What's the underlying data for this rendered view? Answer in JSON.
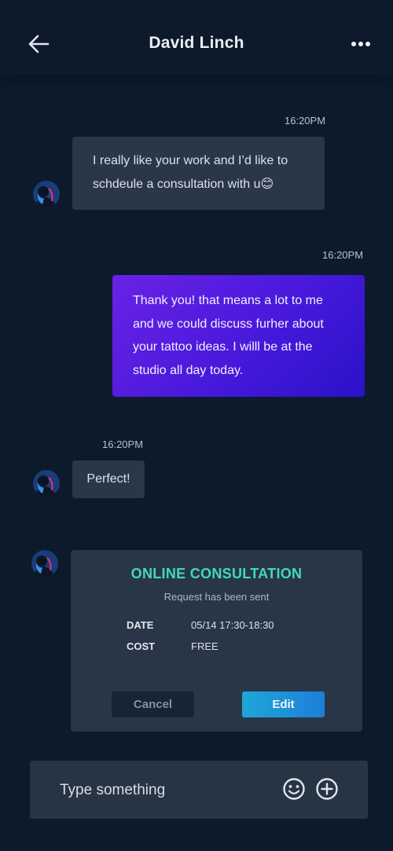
{
  "header": {
    "title": "David Linch"
  },
  "messages": [
    {
      "time": "16:20PM",
      "text_line1": "I really like your work and I’d like to",
      "text_line2": "schdeule a consultation with u",
      "emoji": "😊"
    },
    {
      "time": "16:20PM",
      "lines": [
        "Thank you! that means a lot to me",
        "and we could discuss furher about",
        "your tattoo ideas. I willl be at the",
        "studio all day today."
      ]
    },
    {
      "time": "16:20PM",
      "text": "Perfect!"
    }
  ],
  "consultation": {
    "title": "ONLINE CONSULTATION",
    "subtitle": "Request has been sent",
    "date_label": "DATE",
    "date_value": "05/14 17:30-18:30",
    "cost_label": "COST",
    "cost_value": "FREE",
    "cancel_label": "Cancel",
    "edit_label": "Edit"
  },
  "composer": {
    "placeholder": "Type something"
  },
  "colors": {
    "background": "#0c1a2c",
    "bubble_in": "#2a3748",
    "accent_teal": "#43d9b8",
    "outgoing_gradient_start": "#6a22e6",
    "outgoing_gradient_end": "#2a12c9",
    "edit_button": "#1d8fd8"
  },
  "icons": [
    "back-arrow-icon",
    "more-options-icon",
    "emoji-icon",
    "add-icon"
  ]
}
